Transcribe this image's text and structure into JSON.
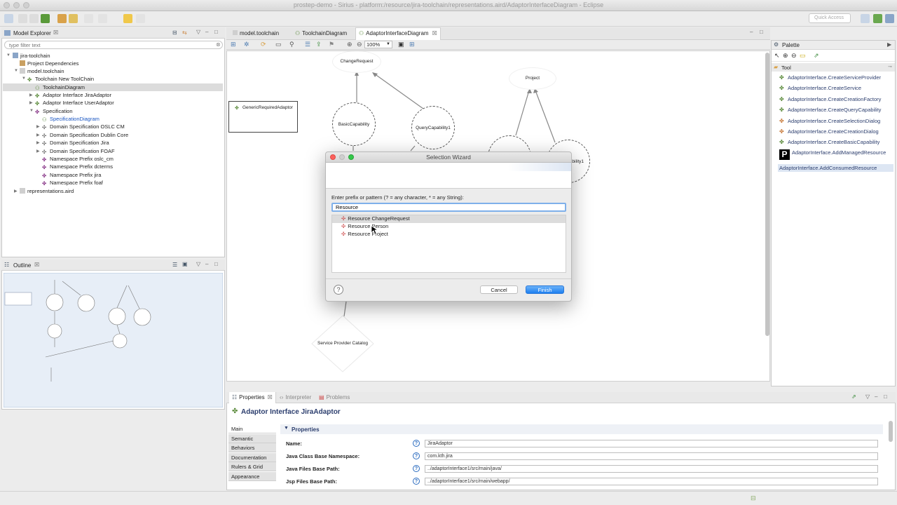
{
  "window": {
    "title": "prostep-demo - Sirius - platform:/resource/jira-toolchain/representations.aird/AdaptorInterfaceDiagram - Eclipse"
  },
  "toolbar": {
    "quick_access": "Quick Access"
  },
  "model_explorer": {
    "tab": "Model Explorer",
    "filter_placeholder": "type filter text",
    "items": [
      {
        "label": "jira-toolchain"
      },
      {
        "label": "Project Dependencies"
      },
      {
        "label": "model.toolchain"
      },
      {
        "label": "Toolchain New ToolChain"
      },
      {
        "label": "ToolchainDiagram"
      },
      {
        "label": "Adaptor Interface JiraAdaptor"
      },
      {
        "label": "Adaptor Interface UserAdaptor"
      },
      {
        "label": "Specification"
      },
      {
        "label": "SpecificationDiagram"
      },
      {
        "label": "Domain Specification OSLC CM"
      },
      {
        "label": "Domain Specification Dublin Core"
      },
      {
        "label": "Domain Specification Jira"
      },
      {
        "label": "Domain Specification FOAF"
      },
      {
        "label": "Namespace Prefix oslc_cm"
      },
      {
        "label": "Namespace Prefix dcterms"
      },
      {
        "label": "Namespace Prefix jira"
      },
      {
        "label": "Namespace Prefix foaf"
      },
      {
        "label": "representations.aird"
      }
    ]
  },
  "outline": {
    "tab": "Outline"
  },
  "editor": {
    "tabs": [
      {
        "label": "model.toolchain"
      },
      {
        "label": "ToolchainDiagram"
      },
      {
        "label": "AdaptorInterfaceDiagram"
      }
    ],
    "zoom": "100%",
    "nodes": {
      "change_request": "ChangeRequest",
      "basic_capability": "BasicCapability",
      "query_capability": "QueryCapability1",
      "project": "Project",
      "capability1_partial": "ability1",
      "generic_adaptor": "GenericRequiredAdaptor",
      "service_provider_catalog": "Service Provider Catalog"
    }
  },
  "palette": {
    "title": "Palette",
    "group": "Tool",
    "items": [
      {
        "label": "AdaptorInterface.CreateServiceProvider"
      },
      {
        "label": "AdaptorInterface.CreateService"
      },
      {
        "label": "AdaptorInterface.CreateCreationFactory"
      },
      {
        "label": "AdaptorInterface.CreateQueryCapability"
      },
      {
        "label": "AdaptorInterface.CreateSelectionDialog"
      },
      {
        "label": "AdaptorInterface.CreateCreationDialog"
      },
      {
        "label": "AdaptorInterface.CreateBasicCapability"
      },
      {
        "label": "AdaptorInterface.AddManagedResource"
      },
      {
        "label": "AdaptorInterface.AddConsumedResource"
      }
    ],
    "badge": "P"
  },
  "dialog": {
    "title": "Selection Wizard",
    "prompt": "Enter prefix or pattern (? = any character, * = any String):",
    "input_value": "Resource",
    "results": [
      {
        "label": "Resource ChangeRequest"
      },
      {
        "label": "Resource Person"
      },
      {
        "label": "Resource Project"
      }
    ],
    "cancel": "Cancel",
    "finish": "Finish",
    "help": "?"
  },
  "properties": {
    "tabs": [
      {
        "label": "Properties"
      },
      {
        "label": "Interpreter"
      },
      {
        "label": "Problems"
      }
    ],
    "header": "Adaptor Interface JiraAdaptor",
    "side_tabs": [
      {
        "label": "Main"
      },
      {
        "label": "Semantic"
      },
      {
        "label": "Behaviors"
      },
      {
        "label": "Documentation"
      },
      {
        "label": "Rulers & Grid"
      },
      {
        "label": "Appearance"
      }
    ],
    "section": "Properties",
    "fields": [
      {
        "label": "Name:",
        "value": "JiraAdaptor"
      },
      {
        "label": "Java Class Base Namespace:",
        "value": "com.kth.jira"
      },
      {
        "label": "Java Files Base Path:",
        "value": "../adaptorInterface1/src/main/java/"
      },
      {
        "label": "Jsp Files Base Path:",
        "value": "../adaptorInterface1/src/main/webapp/"
      }
    ]
  }
}
